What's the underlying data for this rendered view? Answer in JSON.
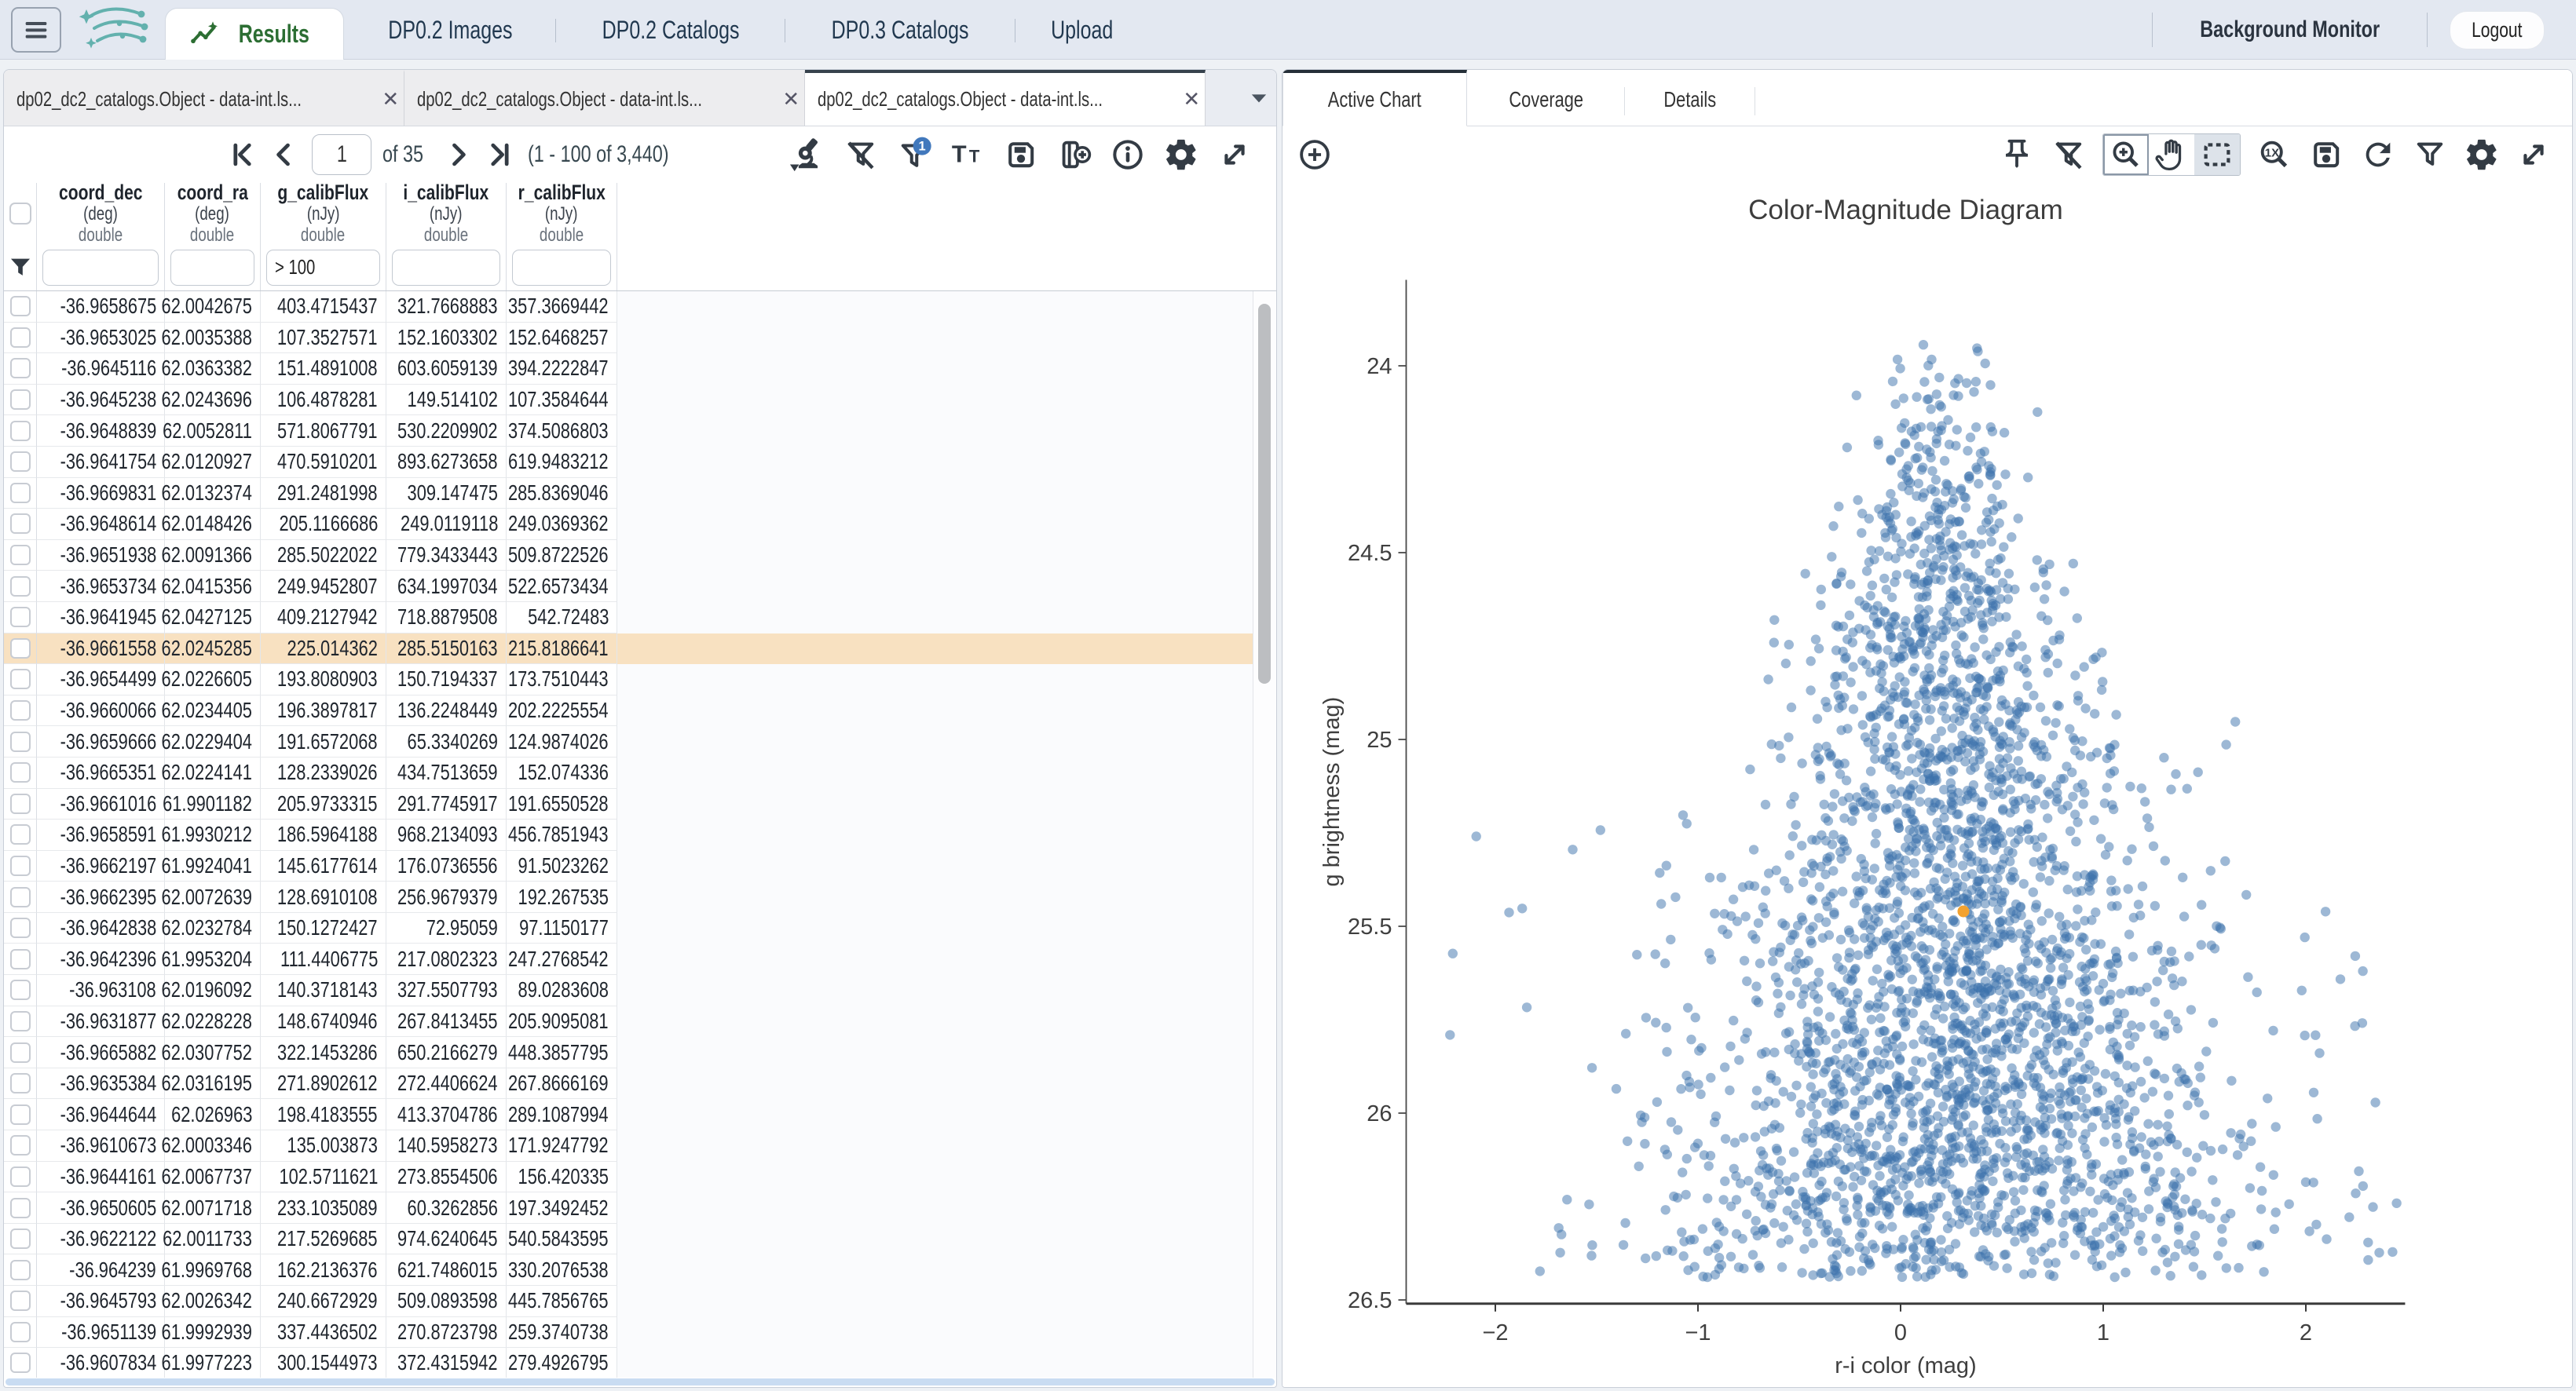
{
  "topbar": {
    "tabs": [
      {
        "label": "Results",
        "active": true
      },
      {
        "label": "DP0.2 Images",
        "active": false
      },
      {
        "label": "DP0.2 Catalogs",
        "active": false
      },
      {
        "label": "DP0.3 Catalogs",
        "active": false
      },
      {
        "label": "Upload",
        "active": false
      }
    ],
    "background_monitor_label": "Background Monitor",
    "logout_label": "Logout"
  },
  "table_panel": {
    "tabs": [
      {
        "label": "dp02_dc2_catalogs.Object - data-int.ls...",
        "active": false
      },
      {
        "label": "dp02_dc2_catalogs.Object - data-int.ls...",
        "active": false
      },
      {
        "label": "dp02_dc2_catalogs.Object - data-int.ls...",
        "active": true
      }
    ],
    "pagination": {
      "page": "1",
      "of_label": "of 35",
      "range_label": "(1 - 100 of 3,440)"
    },
    "toolbar_icons": [
      "microscope",
      "filter-clear",
      "filter-badge",
      "text-view",
      "save",
      "add-column",
      "info",
      "settings",
      "expand"
    ],
    "filter_badge": "1",
    "columns": [
      {
        "name": "coord_dec",
        "unit": "(deg)",
        "type": "double",
        "filter": "",
        "width": 163
      },
      {
        "name": "coord_ra",
        "unit": "(deg)",
        "type": "double",
        "filter": "",
        "width": 122
      },
      {
        "name": "g_calibFlux",
        "unit": "(nJy)",
        "type": "double",
        "filter": "> 100",
        "width": 160
      },
      {
        "name": "i_calibFlux",
        "unit": "(nJy)",
        "type": "double",
        "filter": "",
        "width": 153
      },
      {
        "name": "r_calibFlux",
        "unit": "(nJy)",
        "type": "double",
        "filter": "",
        "width": 141
      }
    ],
    "highlighted_row_index": 11,
    "rows": [
      [
        "-36.9658675",
        "62.0042675",
        "403.4715437",
        "321.7668883",
        "357.3669442"
      ],
      [
        "-36.9653025",
        "62.0035388",
        "107.3527571",
        "152.1603302",
        "152.6468257"
      ],
      [
        "-36.9645116",
        "62.0363382",
        "151.4891008",
        "603.6059139",
        "394.2222847"
      ],
      [
        "-36.9645238",
        "62.0243696",
        "106.4878281",
        "149.514102",
        "107.3584644"
      ],
      [
        "-36.9648839",
        "62.0052811",
        "571.8067791",
        "530.2209902",
        "374.5086803"
      ],
      [
        "-36.9641754",
        "62.0120927",
        "470.5910201",
        "893.6273658",
        "619.9483212"
      ],
      [
        "-36.9669831",
        "62.0132374",
        "291.2481998",
        "309.147475",
        "285.8369046"
      ],
      [
        "-36.9648614",
        "62.0148426",
        "205.1166686",
        "249.0119118",
        "249.0369362"
      ],
      [
        "-36.9651938",
        "62.0091366",
        "285.5022022",
        "779.3433443",
        "509.8722526"
      ],
      [
        "-36.9653734",
        "62.0415356",
        "249.9452807",
        "634.1997034",
        "522.6573434"
      ],
      [
        "-36.9641945",
        "62.0427125",
        "409.2127942",
        "718.8879508",
        "542.72483"
      ],
      [
        "-36.9661558",
        "62.0245285",
        "225.014362",
        "285.5150163",
        "215.8186641"
      ],
      [
        "-36.9654499",
        "62.0226605",
        "193.8080903",
        "150.7194337",
        "173.7510443"
      ],
      [
        "-36.9660066",
        "62.0234405",
        "196.3897817",
        "136.2248449",
        "202.2225554"
      ],
      [
        "-36.9659666",
        "62.0229404",
        "191.6572068",
        "65.3340269",
        "124.9874026"
      ],
      [
        "-36.9665351",
        "62.0224141",
        "128.2339026",
        "434.7513659",
        "152.074336"
      ],
      [
        "-36.9661016",
        "61.9901182",
        "205.9733315",
        "291.7745917",
        "191.6550528"
      ],
      [
        "-36.9658591",
        "61.9930212",
        "186.5964188",
        "968.2134093",
        "456.7851943"
      ],
      [
        "-36.9662197",
        "61.9924041",
        "145.6177614",
        "176.0736556",
        "91.5023262"
      ],
      [
        "-36.9662395",
        "62.0072639",
        "128.6910108",
        "256.9679379",
        "192.267535"
      ],
      [
        "-36.9642838",
        "62.0232784",
        "150.1272427",
        "72.95059",
        "97.1150177"
      ],
      [
        "-36.9642396",
        "61.9953204",
        "111.4406775",
        "217.0802323",
        "247.2768542"
      ],
      [
        "-36.963108",
        "62.0196092",
        "140.3718143",
        "327.5507793",
        "89.0283608"
      ],
      [
        "-36.9631877",
        "62.0228228",
        "148.6740946",
        "267.8413455",
        "205.9095081"
      ],
      [
        "-36.9665882",
        "62.0307752",
        "322.1453286",
        "650.2166279",
        "448.3857795"
      ],
      [
        "-36.9635384",
        "62.0316195",
        "271.8902612",
        "272.4406624",
        "267.8666169"
      ],
      [
        "-36.9644644",
        "62.026963",
        "198.4183555",
        "413.3704786",
        "289.1087994"
      ],
      [
        "-36.9610673",
        "62.0003346",
        "135.003873",
        "140.5958273",
        "171.9247792"
      ],
      [
        "-36.9644161",
        "62.0067737",
        "102.5711621",
        "273.8554506",
        "156.420335"
      ],
      [
        "-36.9650605",
        "62.0071718",
        "233.1035089",
        "60.3262856",
        "197.3492452"
      ],
      [
        "-36.9622122",
        "62.0011733",
        "217.5269685",
        "974.6240645",
        "540.5843595"
      ],
      [
        "-36.964239",
        "61.9969768",
        "162.2136376",
        "621.7486015",
        "330.2076538"
      ],
      [
        "-36.9645793",
        "62.0026342",
        "240.6672929",
        "509.0893598",
        "445.7856765"
      ],
      [
        "-36.9651139",
        "61.9992939",
        "337.4436502",
        "270.8723798",
        "259.3740738"
      ],
      [
        "-36.9607834",
        "61.9977223",
        "300.1544973",
        "372.4315942",
        "279.4926795"
      ]
    ]
  },
  "chart_panel": {
    "tabs": [
      {
        "label": "Active Chart",
        "active": true
      },
      {
        "label": "Coverage",
        "active": false
      },
      {
        "label": "Details",
        "active": false
      }
    ],
    "toolbar_icons_right": [
      "pin",
      "filter-clear",
      "mode-zoom",
      "mode-pan",
      "mode-select",
      "zoom-1x",
      "save",
      "refresh",
      "filter",
      "settings",
      "expand"
    ]
  },
  "chart_data": {
    "type": "scatter",
    "title": "Color-Magnitude Diagram",
    "xlabel": "r-i color (mag)",
    "ylabel": "g brightness (mag)",
    "x_ticks": [
      -2,
      -1,
      0,
      1,
      2
    ],
    "y_ticks": [
      24,
      24.5,
      25,
      25.5,
      26,
      26.5
    ],
    "xlim": [
      -2.44,
      2.49
    ],
    "ylim": [
      26.51,
      23.77
    ],
    "y_axis_reversed": true,
    "grid": false,
    "marker": {
      "color": "#3c72ab",
      "opacity": 0.5,
      "radius_px": 6.2
    },
    "selected_point": {
      "x": 0.31,
      "y": 25.46,
      "color": "#f2a230",
      "radius_px": 7.5
    },
    "n_points": 3300,
    "seed": 987123,
    "distribution": {
      "comment": "synthetic approximation of the 3440-row point cloud",
      "g_min": 23.88,
      "g_span": 2.56,
      "color_mean_base": 0.18,
      "color_mean_slope": 0.06,
      "color_sigma_base": 0.1,
      "color_sigma_slope": 0.27,
      "outlier_fraction": 0.035,
      "outlier_x_range": [
        -2.35,
        2.45
      ],
      "faint_taper_start": 26.24,
      "faint_taper_max_drop": 0.55
    }
  }
}
